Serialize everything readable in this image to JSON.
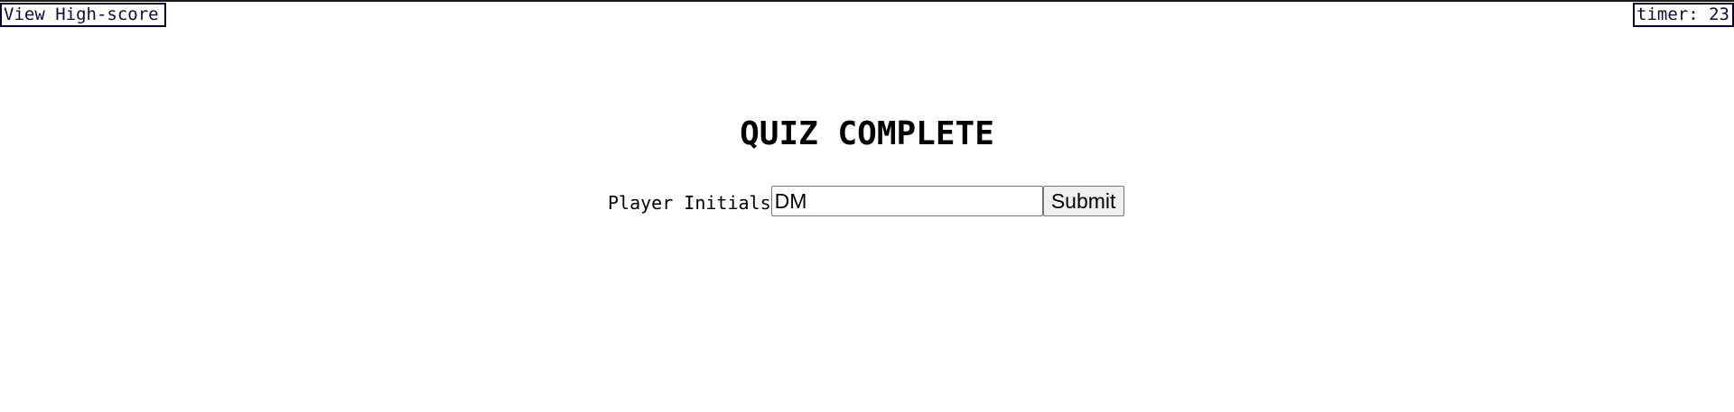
{
  "header": {
    "highscore_link": "View High-score",
    "timer_text": "timer: 23"
  },
  "main": {
    "title": "QUIZ COMPLETE",
    "form": {
      "label": "Player Initials",
      "input_value": "DM",
      "submit_label": "Submit"
    }
  }
}
